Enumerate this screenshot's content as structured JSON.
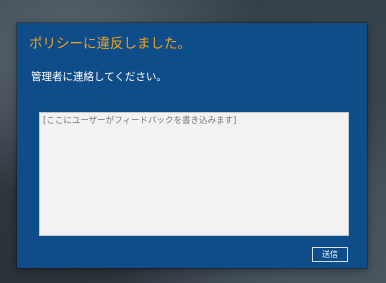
{
  "dialog": {
    "title": "ポリシーに違反しました。",
    "message": "管理者に連絡してください。",
    "feedback": {
      "placeholder": "[ここにユーザーがフィードバックを書き込みます]",
      "value": ""
    },
    "send_label": "送信"
  },
  "colors": {
    "dialog_background": "#0f4d8a",
    "title_text": "#f3a21b",
    "message_text": "#ffffff",
    "input_background": "#f2f2f2"
  }
}
